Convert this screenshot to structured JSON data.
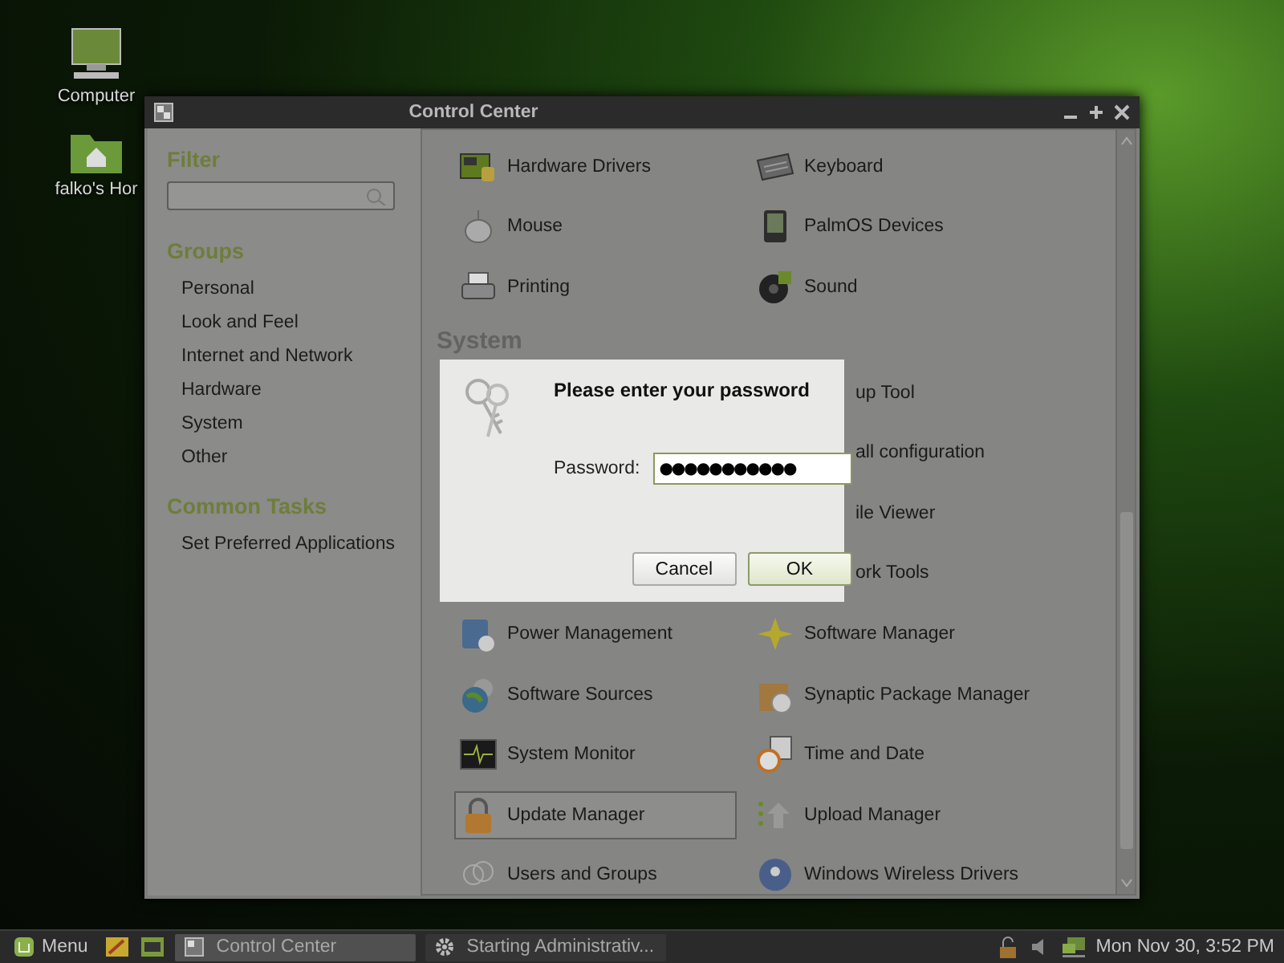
{
  "desktop_icons": [
    {
      "label": "Computer"
    },
    {
      "label": "falko's Hor"
    }
  ],
  "window": {
    "title": "Control Center"
  },
  "sidebar": {
    "filter_heading": "Filter",
    "groups_heading": "Groups",
    "groups": [
      {
        "label": "Personal"
      },
      {
        "label": "Look and Feel"
      },
      {
        "label": "Internet and Network"
      },
      {
        "label": "Hardware"
      },
      {
        "label": "System"
      },
      {
        "label": "Other"
      }
    ],
    "tasks_heading": "Common Tasks",
    "tasks": [
      {
        "label": "Set Preferred Applications"
      }
    ]
  },
  "sections": [
    {
      "rows": [
        {
          "left": {
            "label": "Hardware Drivers",
            "selected": false
          },
          "right": {
            "label": "Keyboard",
            "selected": false
          }
        },
        {
          "left": {
            "label": "Mouse",
            "selected": false
          },
          "right": {
            "label": "PalmOS Devices",
            "selected": false
          }
        },
        {
          "left": {
            "label": "Printing",
            "selected": false
          },
          "right": {
            "label": "Sound",
            "selected": false
          }
        }
      ]
    },
    {
      "heading": "System",
      "rows": [
        {
          "right": {
            "label": "up Tool",
            "kind": "partial",
            "selected": false
          }
        },
        {
          "right": {
            "label": "all configuration",
            "kind": "partial",
            "selected": false
          }
        },
        {
          "right": {
            "label": "ile Viewer",
            "kind": "partial",
            "selected": false
          }
        },
        {
          "right": {
            "label": "ork Tools",
            "kind": "partial",
            "selected": false
          }
        },
        {
          "left": {
            "label": "Power Management",
            "selected": false
          },
          "right": {
            "label": "Software Manager",
            "selected": false
          }
        },
        {
          "left": {
            "label": "Software Sources",
            "selected": false
          },
          "right": {
            "label": "Synaptic Package Manager",
            "selected": false
          }
        },
        {
          "left": {
            "label": "System Monitor",
            "selected": false
          },
          "right": {
            "label": "Time and Date",
            "selected": false
          }
        },
        {
          "left": {
            "label": "Update Manager",
            "selected": true
          },
          "right": {
            "label": "Upload Manager",
            "selected": false
          }
        },
        {
          "left": {
            "label": "Users and Groups",
            "selected": false
          },
          "right": {
            "label": "Windows Wireless Drivers",
            "selected": false
          }
        }
      ]
    }
  ],
  "dialog": {
    "title": "Please enter your password",
    "password_label": "Password:",
    "password_value": "●●●●●●●●●●●",
    "buttons": [
      {
        "label": "Cancel",
        "default": false
      },
      {
        "label": "OK",
        "default": true
      }
    ]
  },
  "taskbar": {
    "menu_label": "Menu",
    "tasks": [
      {
        "label": "Control Center",
        "selected": true
      },
      {
        "label": "Starting Administrativ...",
        "selected": false
      }
    ],
    "clock": "Mon Nov 30,  3:52 PM"
  }
}
